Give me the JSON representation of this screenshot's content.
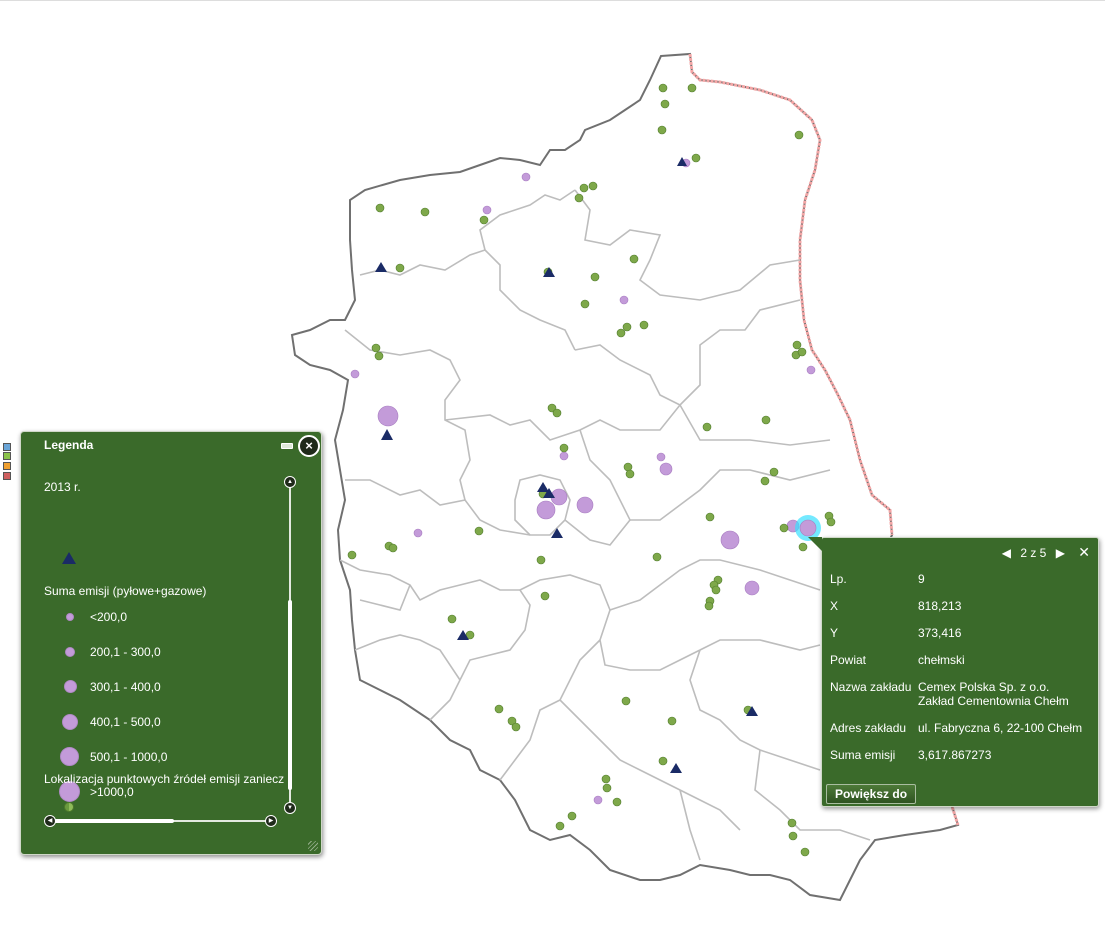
{
  "legend": {
    "title": "Legenda",
    "layer_title": "2013 r.",
    "group_label": "Suma emisji (pyłowe+gazowe)",
    "classes": [
      {
        "label": "<200,0"
      },
      {
        "label": "200,1 - 300,0"
      },
      {
        "label": "300,1 - 400,0"
      },
      {
        "label": "400,1 - 500,0"
      },
      {
        "label": "500,1 - 1000,0"
      },
      {
        "label": ">1000,0"
      }
    ],
    "layer2_label": "Lokalizacja punktowych źródeł emisji zanieczyszczeń"
  },
  "popup": {
    "pager": "2 z 5",
    "fields": [
      {
        "key": "Lp.",
        "value": "9"
      },
      {
        "key": "X",
        "value": "818,213"
      },
      {
        "key": "Y",
        "value": "373,416"
      },
      {
        "key": "Powiat",
        "value": "chełmski"
      },
      {
        "key": "Nazwa zakładu",
        "value": "Cemex Polska Sp. z o.o.\nZakład Cementownia Chełm"
      },
      {
        "key": "Adres zakładu",
        "value": "ul. Fabryczna 6, 22-100 Chełm"
      },
      {
        "key": "Suma emisji",
        "value": "3,617.867273"
      }
    ],
    "zoom_label": "Powiększ do"
  },
  "colors": {
    "panel_bg": "#3a6a2a",
    "emission_purple": "#c39bd9",
    "source_green": "#7ea84a",
    "triangle_navy": "#1a2b66",
    "border_dark": "#707070",
    "border_light": "#c0c0c0",
    "state_border": "#f4a6a6",
    "highlight": "#39e0ff"
  }
}
